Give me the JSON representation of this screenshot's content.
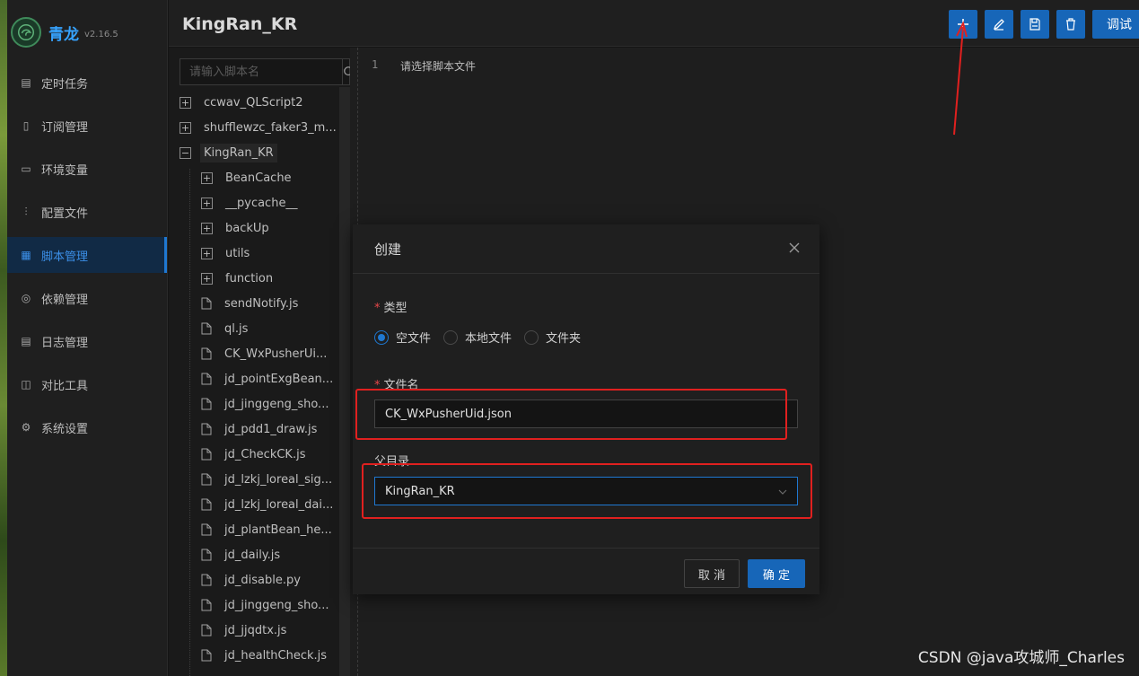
{
  "app": {
    "title": "青龙",
    "version": "v2.16.5"
  },
  "sidebar": {
    "items": [
      {
        "label": "定时任务",
        "icon": "calendar-icon"
      },
      {
        "label": "订阅管理",
        "icon": "subscription-icon"
      },
      {
        "label": "环境变量",
        "icon": "monitor-icon"
      },
      {
        "label": "配置文件",
        "icon": "sliders-icon"
      },
      {
        "label": "脚本管理",
        "icon": "script-icon",
        "active": true
      },
      {
        "label": "依赖管理",
        "icon": "dependency-icon"
      },
      {
        "label": "日志管理",
        "icon": "log-icon"
      },
      {
        "label": "对比工具",
        "icon": "diff-icon"
      },
      {
        "label": "系统设置",
        "icon": "gear-icon"
      }
    ]
  },
  "header": {
    "title": "KingRan_KR",
    "debug_label": "调试"
  },
  "tree": {
    "search_placeholder": "请输入脚本名",
    "nodes": [
      {
        "label": "ccwav_QLScript2",
        "type": "folder-collapsed",
        "depth": 0
      },
      {
        "label": "shufflewzc_faker3_m...",
        "type": "folder-collapsed",
        "depth": 0
      },
      {
        "label": "KingRan_KR",
        "type": "folder-expanded",
        "depth": 0,
        "selected": true
      },
      {
        "label": "BeanCache",
        "type": "folder-collapsed",
        "depth": 1
      },
      {
        "label": "__pycache__",
        "type": "folder-collapsed",
        "depth": 1
      },
      {
        "label": "backUp",
        "type": "folder-collapsed",
        "depth": 1
      },
      {
        "label": "utils",
        "type": "folder-collapsed",
        "depth": 1
      },
      {
        "label": "function",
        "type": "folder-collapsed",
        "depth": 1
      },
      {
        "label": "sendNotify.js",
        "type": "file",
        "depth": 1
      },
      {
        "label": "ql.js",
        "type": "file",
        "depth": 1
      },
      {
        "label": "CK_WxPusherUi...",
        "type": "file",
        "depth": 1
      },
      {
        "label": "jd_pointExgBean...",
        "type": "file",
        "depth": 1
      },
      {
        "label": "jd_jinggeng_sho...",
        "type": "file",
        "depth": 1
      },
      {
        "label": "jd_pdd1_draw.js",
        "type": "file",
        "depth": 1
      },
      {
        "label": "jd_CheckCK.js",
        "type": "file",
        "depth": 1
      },
      {
        "label": "jd_lzkj_loreal_sig...",
        "type": "file",
        "depth": 1
      },
      {
        "label": "jd_lzkj_loreal_dai...",
        "type": "file",
        "depth": 1
      },
      {
        "label": "jd_plantBean_he...",
        "type": "file",
        "depth": 1
      },
      {
        "label": "jd_daily.js",
        "type": "file",
        "depth": 1
      },
      {
        "label": "jd_disable.py",
        "type": "file",
        "depth": 1
      },
      {
        "label": "jd_jinggeng_sho...",
        "type": "file",
        "depth": 1
      },
      {
        "label": "jd_jjqdtx.js",
        "type": "file",
        "depth": 1
      },
      {
        "label": "jd_healthCheck.js",
        "type": "file",
        "depth": 1
      }
    ]
  },
  "editor": {
    "line_number": "1",
    "text": "请选择脚本文件"
  },
  "modal": {
    "title": "创建",
    "type_label": "类型",
    "type_options": [
      {
        "label": "空文件",
        "checked": true
      },
      {
        "label": "本地文件",
        "checked": false
      },
      {
        "label": "文件夹",
        "checked": false
      }
    ],
    "filename_label": "文件名",
    "filename_value": "CK_WxPusherUid.json",
    "parent_label": "父目录",
    "parent_value": "KingRan_KR",
    "cancel_label": "取 消",
    "ok_label": "确 定",
    "required_mark": "*"
  },
  "watermark": "CSDN @java攻城师_Charles",
  "colors": {
    "accent": "#1766b8",
    "active_menu_bg": "#112a45",
    "annotation_red": "#e0201f"
  }
}
